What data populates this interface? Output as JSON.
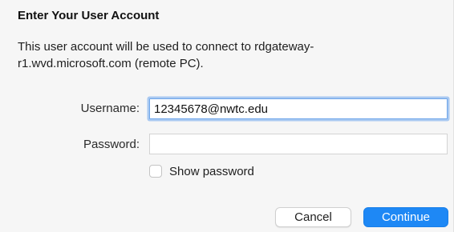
{
  "dialog": {
    "title": "Enter Your User Account",
    "message": "This user account will be used to connect to rdgateway-r1.wvd.microsoft.com (remote PC)."
  },
  "form": {
    "username_label": "Username:",
    "username_value": "12345678@nwtc.edu",
    "password_label": "Password:",
    "password_value": "",
    "show_password_label": "Show password",
    "show_password_checked": false
  },
  "buttons": {
    "cancel_label": "Cancel",
    "continue_label": "Continue"
  },
  "colors": {
    "accent": "#1e88f5",
    "focus_ring": "#a9c9f1"
  }
}
